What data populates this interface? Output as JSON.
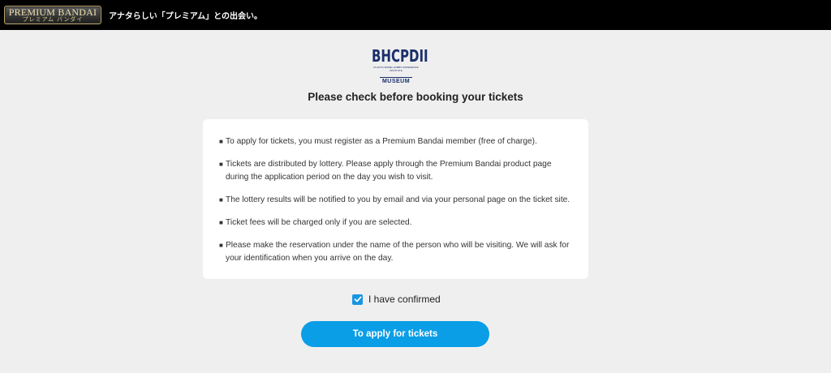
{
  "header": {
    "brand_main": "PREMIUM BANDAI",
    "brand_sub": "プレミアム バンダイ",
    "tagline": "アナタらしい「プレミアム」との出会い。"
  },
  "museum_logo": {
    "wordmark": "BHCPDII",
    "small_text": "PLASTIC MODEL HOBBY EXPERIENCE INSTITUTE",
    "museum": "MUSEUM"
  },
  "main": {
    "title": "Please check before booking your tickets",
    "bullet_glyph": "■",
    "notices": [
      "To apply for tickets, you must register as a Premium Bandai member (free of charge).",
      "Tickets are distributed by lottery. Please apply through the Premium Bandai product page during the application period on the day you wish to visit.",
      "The lottery results will be notified to you by email and via your personal page on the ticket site.",
      "Ticket fees will be charged only if you are selected.",
      "Please make the reservation under the name of the person who will be visiting. We will ask for your identification when you arrive on the day."
    ],
    "confirm_label": "I have confirmed",
    "confirm_checked": true,
    "apply_button": "To apply for tickets"
  },
  "colors": {
    "accent": "#0a9ee6",
    "checkbox": "#1a96e0",
    "logo_navy": "#1a2f6b",
    "background": "#efefef"
  },
  "icons": {
    "checkbox": "check-icon"
  }
}
